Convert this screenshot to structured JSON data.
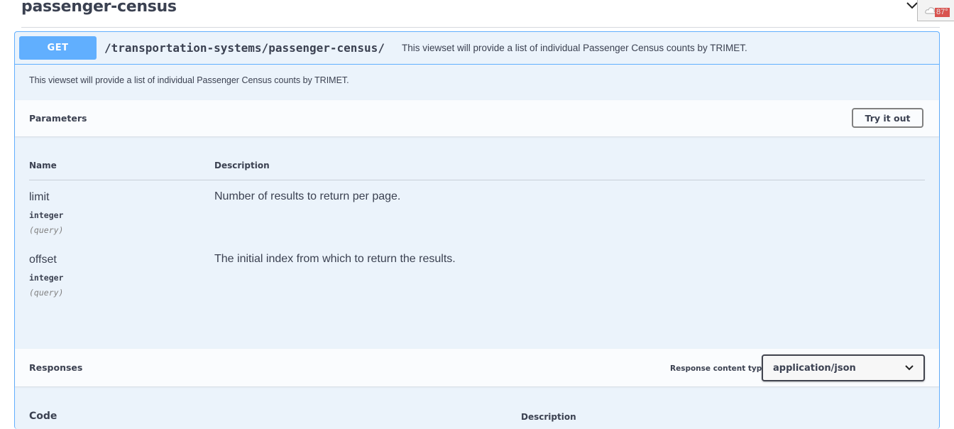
{
  "tag": {
    "title": "passenger-census"
  },
  "weather": {
    "temperature": "87°"
  },
  "operation": {
    "method": "GET",
    "path": "/transportation-systems/passenger-census/",
    "summary": "This viewset will provide a list of individual Passenger Census counts by TRIMET.",
    "description": "This viewset will provide a list of individual Passenger Census counts by TRIMET."
  },
  "parameters": {
    "section_label": "Parameters",
    "try_button_label": "Try it out",
    "columns": {
      "name": "Name",
      "description": "Description"
    },
    "rows": [
      {
        "name": "limit",
        "type": "integer",
        "in": "(query)",
        "description": "Number of results to return per page."
      },
      {
        "name": "offset",
        "type": "integer",
        "in": "(query)",
        "description": "The initial index from which to return the results."
      }
    ]
  },
  "responses": {
    "section_label": "Responses",
    "content_type_label": "Response content type",
    "content_type_value": "application/json",
    "columns": {
      "code": "Code",
      "description": "Description"
    }
  },
  "colors": {
    "get_accent": "#61affe",
    "block_bg": "#ebf3fb",
    "text": "#3b4151"
  },
  "icons": {
    "collapse": "chevron-down-icon",
    "select": "chevron-down-icon",
    "weather": "cloud-icon"
  }
}
